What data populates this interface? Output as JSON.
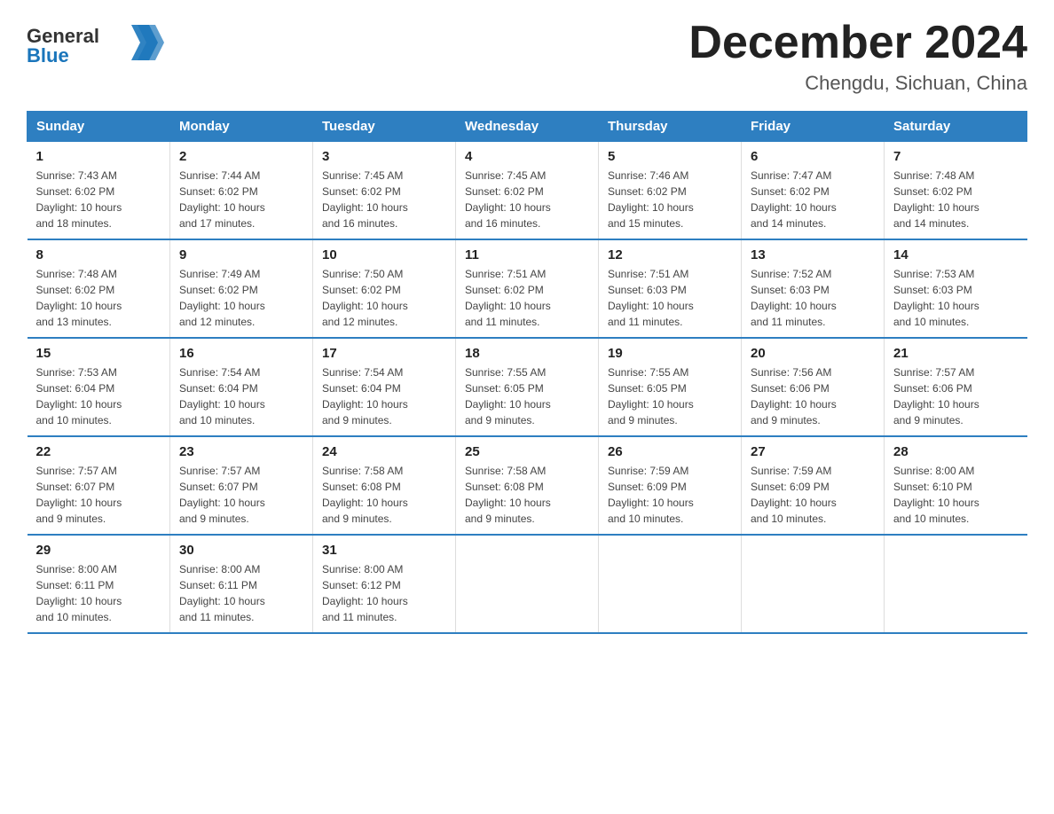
{
  "logo": {
    "name": "General",
    "name2": "Blue"
  },
  "title": "December 2024",
  "subtitle": "Chengdu, Sichuan, China",
  "days_of_week": [
    "Sunday",
    "Monday",
    "Tuesday",
    "Wednesday",
    "Thursday",
    "Friday",
    "Saturday"
  ],
  "weeks": [
    [
      {
        "day": "1",
        "sunrise": "7:43 AM",
        "sunset": "6:02 PM",
        "daylight": "10 hours and 18 minutes."
      },
      {
        "day": "2",
        "sunrise": "7:44 AM",
        "sunset": "6:02 PM",
        "daylight": "10 hours and 17 minutes."
      },
      {
        "day": "3",
        "sunrise": "7:45 AM",
        "sunset": "6:02 PM",
        "daylight": "10 hours and 16 minutes."
      },
      {
        "day": "4",
        "sunrise": "7:45 AM",
        "sunset": "6:02 PM",
        "daylight": "10 hours and 16 minutes."
      },
      {
        "day": "5",
        "sunrise": "7:46 AM",
        "sunset": "6:02 PM",
        "daylight": "10 hours and 15 minutes."
      },
      {
        "day": "6",
        "sunrise": "7:47 AM",
        "sunset": "6:02 PM",
        "daylight": "10 hours and 14 minutes."
      },
      {
        "day": "7",
        "sunrise": "7:48 AM",
        "sunset": "6:02 PM",
        "daylight": "10 hours and 14 minutes."
      }
    ],
    [
      {
        "day": "8",
        "sunrise": "7:48 AM",
        "sunset": "6:02 PM",
        "daylight": "10 hours and 13 minutes."
      },
      {
        "day": "9",
        "sunrise": "7:49 AM",
        "sunset": "6:02 PM",
        "daylight": "10 hours and 12 minutes."
      },
      {
        "day": "10",
        "sunrise": "7:50 AM",
        "sunset": "6:02 PM",
        "daylight": "10 hours and 12 minutes."
      },
      {
        "day": "11",
        "sunrise": "7:51 AM",
        "sunset": "6:02 PM",
        "daylight": "10 hours and 11 minutes."
      },
      {
        "day": "12",
        "sunrise": "7:51 AM",
        "sunset": "6:03 PM",
        "daylight": "10 hours and 11 minutes."
      },
      {
        "day": "13",
        "sunrise": "7:52 AM",
        "sunset": "6:03 PM",
        "daylight": "10 hours and 11 minutes."
      },
      {
        "day": "14",
        "sunrise": "7:53 AM",
        "sunset": "6:03 PM",
        "daylight": "10 hours and 10 minutes."
      }
    ],
    [
      {
        "day": "15",
        "sunrise": "7:53 AM",
        "sunset": "6:04 PM",
        "daylight": "10 hours and 10 minutes."
      },
      {
        "day": "16",
        "sunrise": "7:54 AM",
        "sunset": "6:04 PM",
        "daylight": "10 hours and 10 minutes."
      },
      {
        "day": "17",
        "sunrise": "7:54 AM",
        "sunset": "6:04 PM",
        "daylight": "10 hours and 9 minutes."
      },
      {
        "day": "18",
        "sunrise": "7:55 AM",
        "sunset": "6:05 PM",
        "daylight": "10 hours and 9 minutes."
      },
      {
        "day": "19",
        "sunrise": "7:55 AM",
        "sunset": "6:05 PM",
        "daylight": "10 hours and 9 minutes."
      },
      {
        "day": "20",
        "sunrise": "7:56 AM",
        "sunset": "6:06 PM",
        "daylight": "10 hours and 9 minutes."
      },
      {
        "day": "21",
        "sunrise": "7:57 AM",
        "sunset": "6:06 PM",
        "daylight": "10 hours and 9 minutes."
      }
    ],
    [
      {
        "day": "22",
        "sunrise": "7:57 AM",
        "sunset": "6:07 PM",
        "daylight": "10 hours and 9 minutes."
      },
      {
        "day": "23",
        "sunrise": "7:57 AM",
        "sunset": "6:07 PM",
        "daylight": "10 hours and 9 minutes."
      },
      {
        "day": "24",
        "sunrise": "7:58 AM",
        "sunset": "6:08 PM",
        "daylight": "10 hours and 9 minutes."
      },
      {
        "day": "25",
        "sunrise": "7:58 AM",
        "sunset": "6:08 PM",
        "daylight": "10 hours and 9 minutes."
      },
      {
        "day": "26",
        "sunrise": "7:59 AM",
        "sunset": "6:09 PM",
        "daylight": "10 hours and 10 minutes."
      },
      {
        "day": "27",
        "sunrise": "7:59 AM",
        "sunset": "6:09 PM",
        "daylight": "10 hours and 10 minutes."
      },
      {
        "day": "28",
        "sunrise": "8:00 AM",
        "sunset": "6:10 PM",
        "daylight": "10 hours and 10 minutes."
      }
    ],
    [
      {
        "day": "29",
        "sunrise": "8:00 AM",
        "sunset": "6:11 PM",
        "daylight": "10 hours and 10 minutes."
      },
      {
        "day": "30",
        "sunrise": "8:00 AM",
        "sunset": "6:11 PM",
        "daylight": "10 hours and 11 minutes."
      },
      {
        "day": "31",
        "sunrise": "8:00 AM",
        "sunset": "6:12 PM",
        "daylight": "10 hours and 11 minutes."
      },
      null,
      null,
      null,
      null
    ]
  ]
}
